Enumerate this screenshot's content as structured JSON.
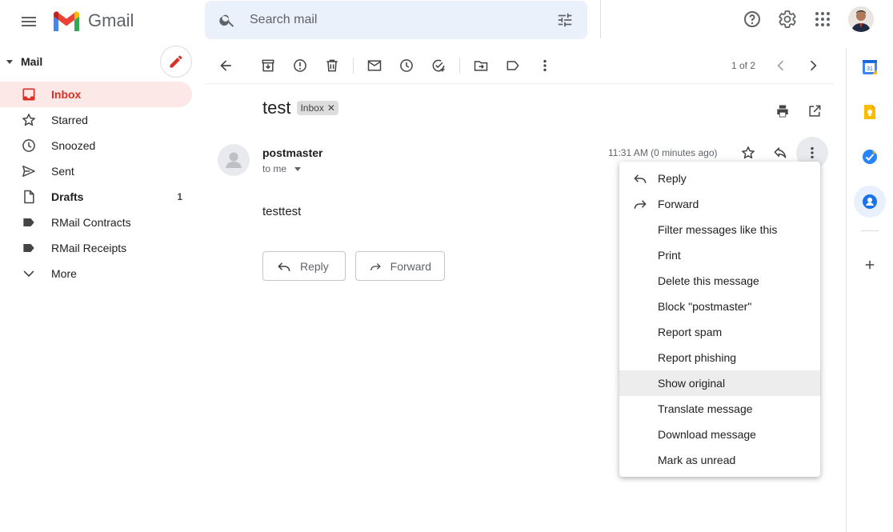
{
  "app": {
    "name": "Gmail"
  },
  "search": {
    "placeholder": "Search mail"
  },
  "nav": {
    "section_label": "Mail",
    "items": [
      {
        "label": "Inbox",
        "count": "",
        "icon": "inbox-icon"
      },
      {
        "label": "Starred",
        "count": "",
        "icon": "star-icon"
      },
      {
        "label": "Snoozed",
        "count": "",
        "icon": "clock-icon"
      },
      {
        "label": "Sent",
        "count": "",
        "icon": "send-icon"
      },
      {
        "label": "Drafts",
        "count": "1",
        "icon": "draft-icon"
      },
      {
        "label": "RMail Contracts",
        "count": "",
        "icon": "label-icon"
      },
      {
        "label": "RMail Receipts",
        "count": "",
        "icon": "label-icon"
      },
      {
        "label": "More",
        "count": "",
        "icon": "chevron-down-icon"
      }
    ]
  },
  "pager": {
    "count": "1 of 2"
  },
  "message": {
    "subject": "test",
    "label": "Inbox",
    "sender": "postmaster",
    "to": "to me",
    "time": "11:31 AM (0 minutes ago)",
    "body": "testtest",
    "reply_label": "Reply",
    "forward_label": "Forward"
  },
  "menu": {
    "items": [
      {
        "label": "Reply",
        "icon": "reply-icon"
      },
      {
        "label": "Forward",
        "icon": "forward-icon"
      },
      {
        "label": "Filter messages like this",
        "icon": ""
      },
      {
        "label": "Print",
        "icon": ""
      },
      {
        "label": "Delete this message",
        "icon": ""
      },
      {
        "label": "Block \"postmaster\"",
        "icon": ""
      },
      {
        "label": "Report spam",
        "icon": ""
      },
      {
        "label": "Report phishing",
        "icon": ""
      },
      {
        "label": "Show original",
        "icon": "",
        "highlighted": true
      },
      {
        "label": "Translate message",
        "icon": ""
      },
      {
        "label": "Download message",
        "icon": ""
      },
      {
        "label": "Mark as unread",
        "icon": ""
      }
    ]
  },
  "colors": {
    "accent_red": "#d93025",
    "search_bg": "#eaf1fb",
    "inbox_active_bg": "#fce8e6",
    "menu_highlight": "#ededed"
  }
}
